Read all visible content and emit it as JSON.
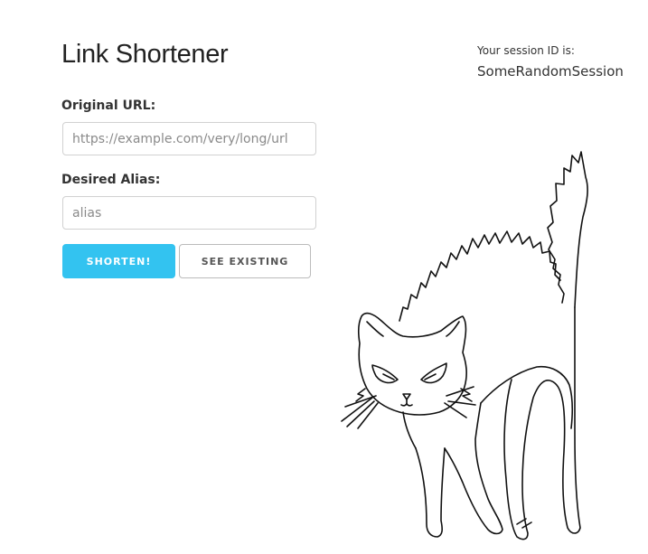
{
  "header": {
    "title": "Link Shortener"
  },
  "session": {
    "caption": "Your session ID is:",
    "id": "SomeRandomSession"
  },
  "form": {
    "url_label": "Original URL:",
    "url_placeholder": "https://example.com/very/long/url",
    "url_value": "",
    "alias_label": "Desired Alias:",
    "alias_placeholder": "alias",
    "alias_value": ""
  },
  "buttons": {
    "shorten_label": "SHORTEN!",
    "existing_label": "SEE EXISTING"
  },
  "colors": {
    "accent": "#33c3f0",
    "text": "#222222",
    "border": "#d1d1d1"
  },
  "illustration": {
    "icon": "cat-illustration"
  }
}
